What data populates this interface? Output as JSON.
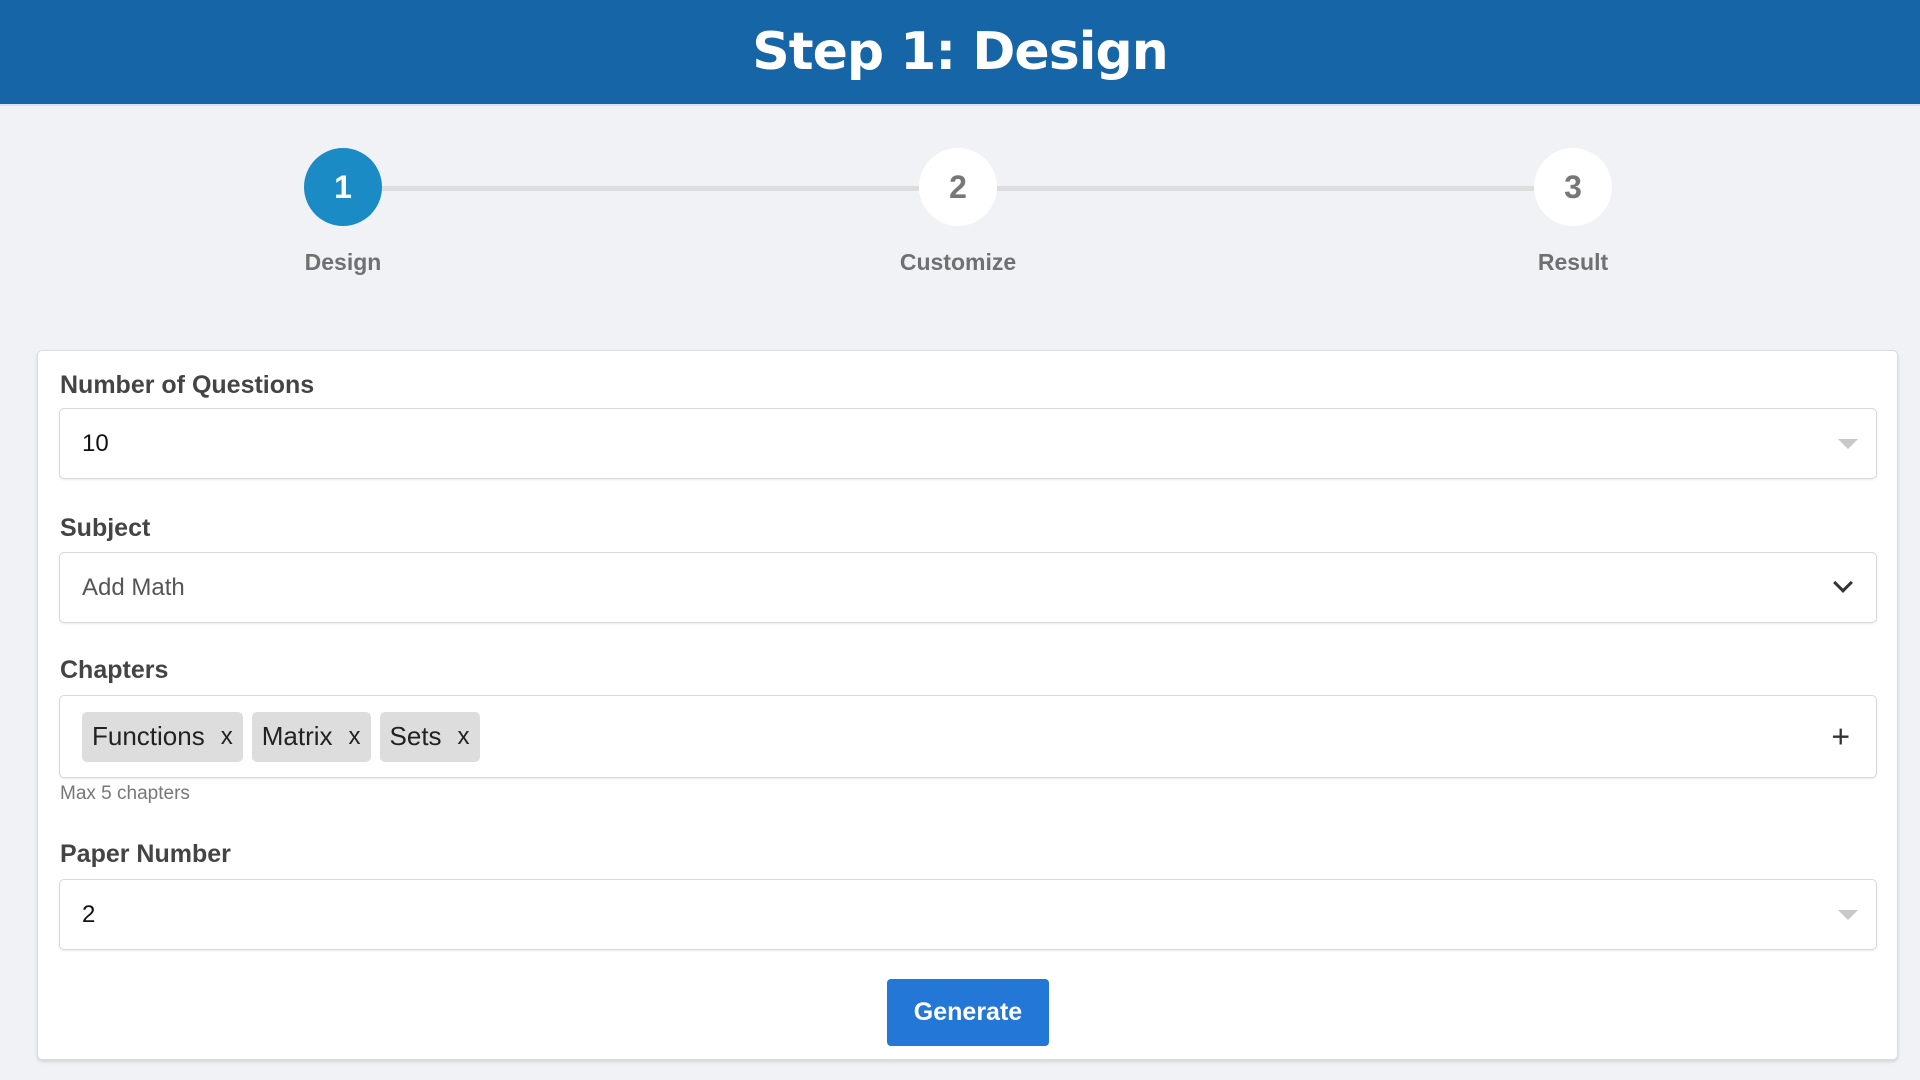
{
  "header": {
    "title": "Step 1: Design"
  },
  "stepper": {
    "steps": [
      {
        "number": "1",
        "label": "Design",
        "active": true
      },
      {
        "number": "2",
        "label": "Customize",
        "active": false
      },
      {
        "number": "3",
        "label": "Result",
        "active": false
      }
    ]
  },
  "form": {
    "num_questions": {
      "label": "Number of Questions",
      "value": "10"
    },
    "subject": {
      "label": "Subject",
      "value": "Add Math"
    },
    "chapters": {
      "label": "Chapters",
      "tags": [
        {
          "label": "Functions",
          "remove": "x"
        },
        {
          "label": "Matrix",
          "remove": "x"
        },
        {
          "label": "Sets",
          "remove": "x"
        }
      ],
      "add": "+",
      "helper": "Max 5 chapters"
    },
    "paper_number": {
      "label": "Paper Number",
      "value": "2"
    },
    "generate_label": "Generate"
  },
  "colors": {
    "header": "#1565a7",
    "active_step": "#1a8bc4",
    "button": "#2377d6"
  }
}
